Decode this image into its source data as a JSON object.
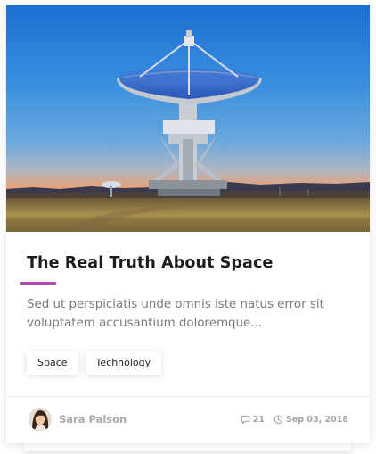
{
  "post": {
    "image_alt": "Radio telescope dish at sunset",
    "title": "The Real Truth About Space",
    "excerpt": "Sed ut perspiciatis unde omnis iste natus error sit voluptatem accusantium doloremque...",
    "accent_color": "#b446b4",
    "tags": [
      "Space",
      "Technology"
    ],
    "author": "Sara Palson",
    "comments": "21",
    "date": "Sep 03, 2018"
  },
  "icons": {
    "comment": "comment-icon",
    "clock": "clock-icon"
  }
}
